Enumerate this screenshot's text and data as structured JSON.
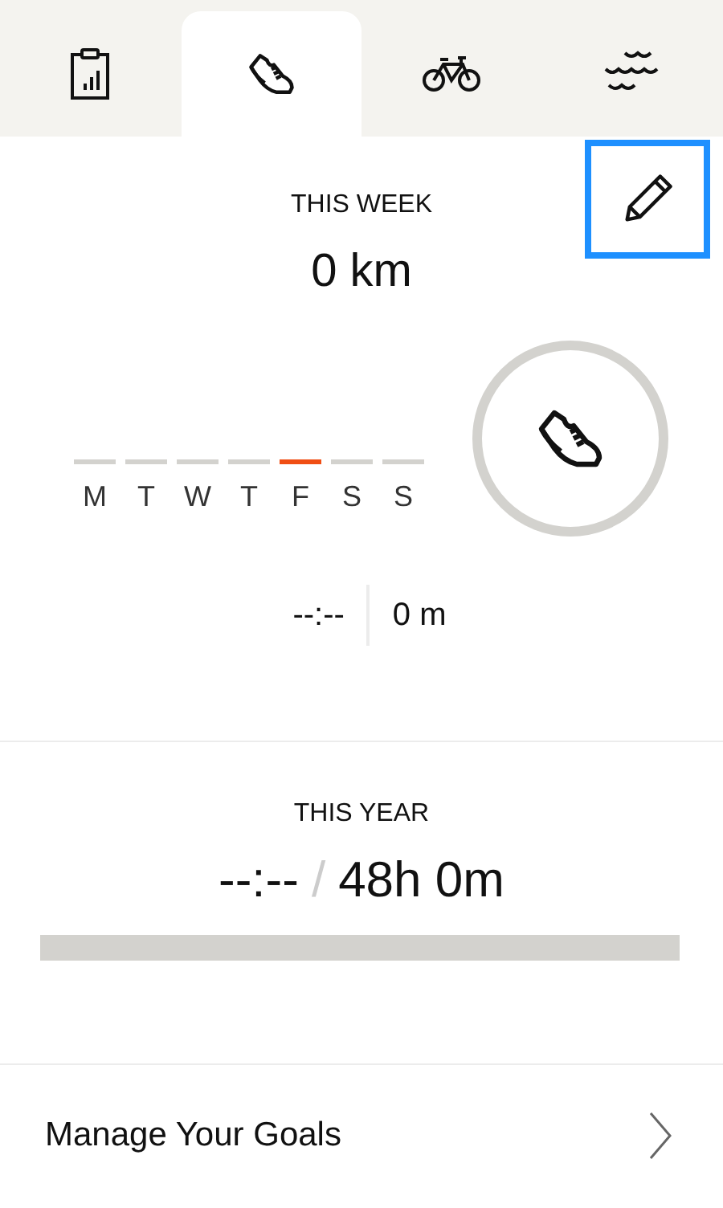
{
  "tabs": [
    {
      "kind": "stats",
      "selected": false
    },
    {
      "kind": "run",
      "selected": true
    },
    {
      "kind": "bike",
      "selected": false
    },
    {
      "kind": "swim",
      "selected": false
    }
  ],
  "this_week": {
    "title": "THIS WEEK",
    "distance": "0 km",
    "days": [
      {
        "label": "M",
        "selected": false
      },
      {
        "label": "T",
        "selected": false
      },
      {
        "label": "W",
        "selected": false
      },
      {
        "label": "T",
        "selected": false
      },
      {
        "label": "F",
        "selected": true
      },
      {
        "label": "S",
        "selected": false
      },
      {
        "label": "S",
        "selected": false
      }
    ],
    "time": "--:--",
    "elevation": "0 m"
  },
  "this_year": {
    "title": "THIS YEAR",
    "time": "--:--",
    "separator": "/",
    "goal": "48h 0m",
    "level": 0
  },
  "manage_goals": {
    "label": "Manage Your Goals"
  }
}
